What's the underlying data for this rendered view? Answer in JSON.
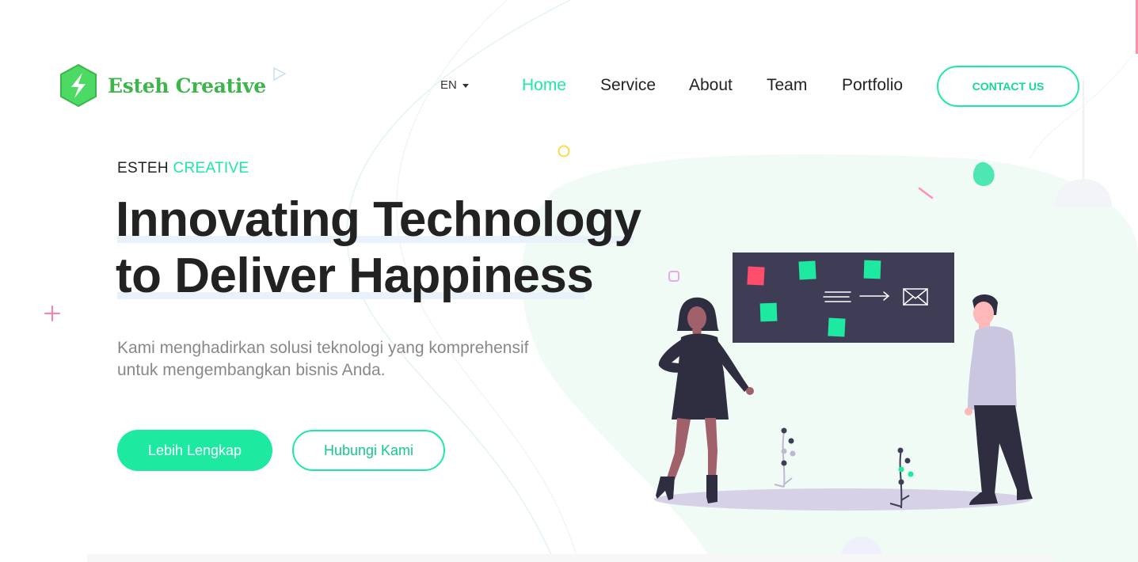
{
  "brand": {
    "name": "Esteh Creative",
    "color": "#3cb54a",
    "accent": "#1de9a0"
  },
  "header": {
    "language": "EN",
    "nav": [
      {
        "label": "Home",
        "active": true
      },
      {
        "label": "Service",
        "active": false
      },
      {
        "label": "About",
        "active": false
      },
      {
        "label": "Team",
        "active": false
      },
      {
        "label": "Portfolio",
        "active": false
      }
    ],
    "contact_label": "CONTACT US"
  },
  "hero": {
    "eyebrow_main": "ESTEH",
    "eyebrow_accent": "CREATIVE",
    "headline_line1": "Innovating Technology",
    "headline_line2": "to Deliver Happiness",
    "description_line1": "Kami menghadirkan solusi teknologi yang komprehensif",
    "description_line2": "untuk mengembangkan bisnis Anda.",
    "primary_button": "Lebih Lengkap",
    "secondary_button": "Hubungi Kami"
  },
  "illustration": {
    "name": "team-presentation-illustration",
    "board_color": "#3f3d56",
    "note_colors": [
      "#ff4d6d",
      "#1de9a0"
    ]
  }
}
